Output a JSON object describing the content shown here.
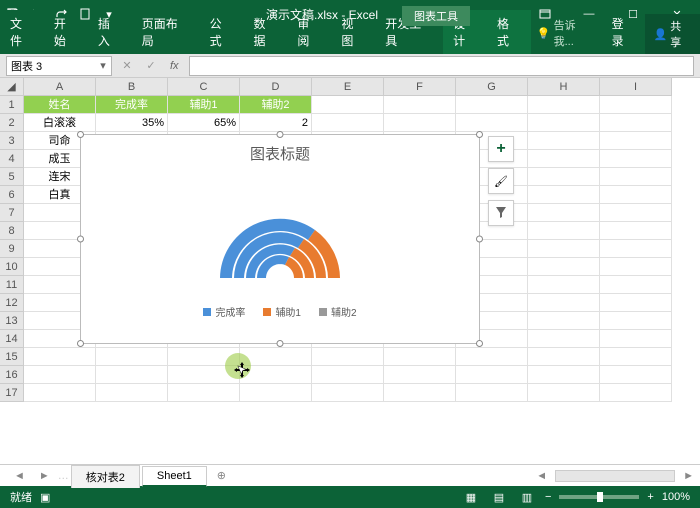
{
  "app": {
    "doc": "演示文稿.xlsx",
    "suffix": "Excel",
    "ctx_group": "图表工具"
  },
  "qat": {
    "save": "💾"
  },
  "tabs": {
    "file": "文件",
    "home": "开始",
    "insert": "插入",
    "layout": "页面布局",
    "formula": "公式",
    "data": "数据",
    "review": "审阅",
    "view": "视图",
    "dev": "开发工具",
    "design": "设计",
    "format": "格式",
    "tell": "告诉我...",
    "login": "登录",
    "share": "共享"
  },
  "namebox": "图表 3",
  "headers": [
    "A",
    "B",
    "C",
    "D",
    "E",
    "F",
    "G",
    "H",
    "I"
  ],
  "table": {
    "h1": "姓名",
    "h2": "完成率",
    "h3": "辅助1",
    "h4": "辅助2",
    "r": [
      {
        "a": "白滚滚",
        "b": "35%",
        "c": "65%",
        "d": "2"
      },
      {
        "a": "司命",
        "b": "",
        "c": "",
        "d": ""
      },
      {
        "a": "成玉",
        "b": "",
        "c": "",
        "d": ""
      },
      {
        "a": "连宋",
        "b": "",
        "c": "",
        "d": ""
      },
      {
        "a": "白真",
        "b": "",
        "c": "",
        "d": ""
      }
    ]
  },
  "chart": {
    "title": "图表标题",
    "legend": [
      "完成率",
      "辅助1",
      "辅助2"
    ]
  },
  "chart_data": {
    "type": "pie",
    "note": "multi-ring doughnut/fan, outer ring largest; each ring split roughly 35% blue / 65% orange based on 完成率 35%; only half-arc shown",
    "series": [
      {
        "name": "完成率",
        "color": "#4a90d9"
      },
      {
        "name": "辅助1",
        "color": "#e87b2f"
      },
      {
        "name": "辅助2",
        "color": "#888"
      }
    ],
    "rings": 4
  },
  "sheets": {
    "s1": "核对表2",
    "s2": "Sheet1"
  },
  "status": {
    "ready": "就绪",
    "zoom": "100%"
  }
}
